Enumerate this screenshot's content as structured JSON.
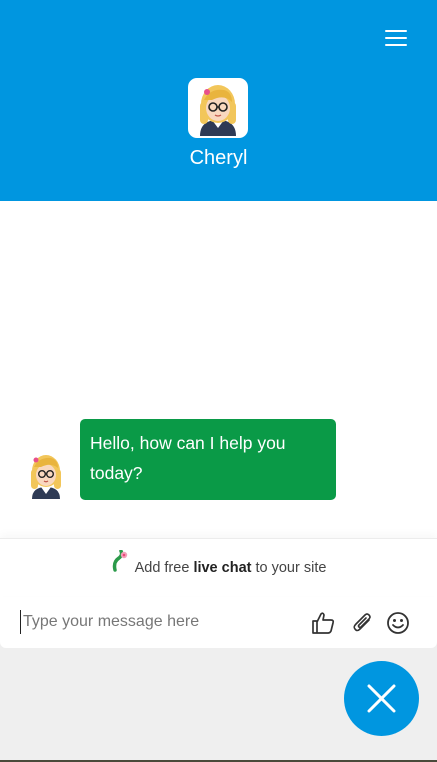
{
  "header": {
    "agent_name": "Cheryl",
    "background_color": "#0096e0"
  },
  "icons": {
    "menu": "hamburger-menu-icon",
    "like": "thumbs-up-icon",
    "attach": "paperclip-icon",
    "emoji": "smiley-icon",
    "close": "close-icon",
    "brand": "brand-logo-icon"
  },
  "messages": [
    {
      "sender": "agent",
      "text": "Hello, how can I help you today?"
    }
  ],
  "branding": {
    "prefix": "Add free",
    "bold": "live chat",
    "suffix": "to your site"
  },
  "composer": {
    "placeholder": "Type your message here",
    "value": ""
  },
  "colors": {
    "accent": "#0096e0",
    "agent_bubble": "#0a9a47"
  }
}
